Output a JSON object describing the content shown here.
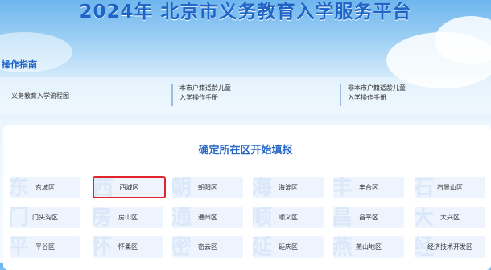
{
  "header": {
    "title": "2024年 北京市义务教育入学服务平台"
  },
  "guide": {
    "label": "操作指南",
    "items": [
      {
        "lines": [
          "义务教育入学流程图"
        ]
      },
      {
        "lines": [
          "本市户籍适龄儿童",
          "入学操作手册"
        ]
      },
      {
        "lines": [
          "非本市户籍适龄儿童",
          "入学操作手册"
        ]
      }
    ]
  },
  "district_panel": {
    "title": "确定所在区开始填报",
    "selected": "西城区",
    "districts": [
      {
        "label": "东城区",
        "bg": "东"
      },
      {
        "label": "西城区",
        "bg": "西"
      },
      {
        "label": "朝阳区",
        "bg": "朝"
      },
      {
        "label": "海淀区",
        "bg": "海"
      },
      {
        "label": "丰台区",
        "bg": "丰"
      },
      {
        "label": "石景山区",
        "bg": "石"
      },
      {
        "label": "门头沟区",
        "bg": "门"
      },
      {
        "label": "房山区",
        "bg": "房"
      },
      {
        "label": "通州区",
        "bg": "通"
      },
      {
        "label": "顺义区",
        "bg": "顺"
      },
      {
        "label": "昌平区",
        "bg": "昌"
      },
      {
        "label": "大兴区",
        "bg": "大"
      },
      {
        "label": "平谷区",
        "bg": "平"
      },
      {
        "label": "怀柔区",
        "bg": "怀"
      },
      {
        "label": "密云区",
        "bg": "密"
      },
      {
        "label": "延庆区",
        "bg": "延"
      },
      {
        "label": "燕山地区",
        "bg": "燕"
      },
      {
        "label": "经济技术开发区",
        "bg": "经"
      }
    ]
  }
}
